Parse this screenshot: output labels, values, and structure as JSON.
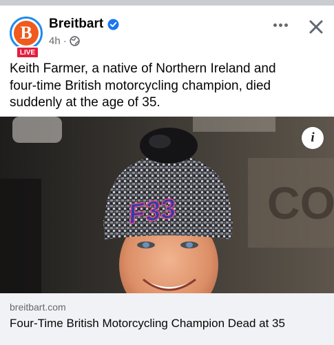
{
  "post": {
    "page_name": "Breitbart",
    "avatar_letter": "B",
    "live_badge": "LIVE",
    "time": "4h",
    "separator": "·",
    "audience_icon": "globe-icon",
    "text": "Keith Farmer, a native of Northern Ireland and four-time British motorcycling champion, died suddenly at the age of 35."
  },
  "image": {
    "hat_logo_text": "F33",
    "info_icon": "i"
  },
  "link": {
    "domain": "breitbart.com",
    "headline": "Four-Time British Motorcycling Champion Dead at 35"
  },
  "colors": {
    "brand_orange": "#ef5a1e",
    "ring_blue": "#1c8cf0",
    "live_red": "#e41e3f",
    "verified_blue": "#1877f2",
    "secondary_text": "#65676b",
    "link_bg": "#f0f2f5"
  },
  "icons": [
    "verified-badge-icon",
    "globe-icon",
    "more-options-icon",
    "close-icon",
    "info-icon"
  ]
}
